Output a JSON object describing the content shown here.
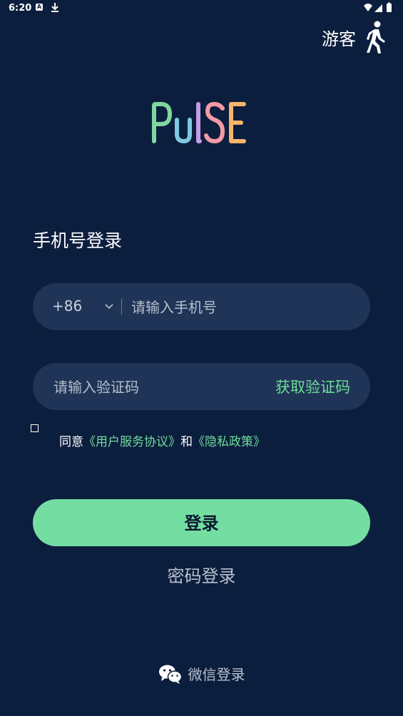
{
  "status_bar": {
    "time": "6:20",
    "notification_letter": "A"
  },
  "guest": {
    "label": "游客"
  },
  "logo": {
    "text": "PULSE",
    "letters": [
      "P",
      "U",
      "L",
      "S",
      "E"
    ],
    "colors": [
      "#7ed7a0",
      "#7fc8e0",
      "#c39be8",
      "#f49aa6",
      "#f5b56c"
    ]
  },
  "login": {
    "title": "手机号登录",
    "country_code": "+86",
    "phone_placeholder": "请输入手机号",
    "code_placeholder": "请输入验证码",
    "get_code_label": "获取验证码",
    "agreement_prefix": "同意",
    "user_agreement_link": "《用户服务协议》",
    "agreement_and": "和",
    "privacy_link": "《隐私政策》",
    "submit_label": "登录",
    "password_login_label": "密码登录"
  },
  "wechat": {
    "label": "微信登录"
  },
  "colors": {
    "background": "#0c1e3d",
    "field": "#1f3456",
    "accent": "#74dea2",
    "link": "#6fdc9c"
  }
}
